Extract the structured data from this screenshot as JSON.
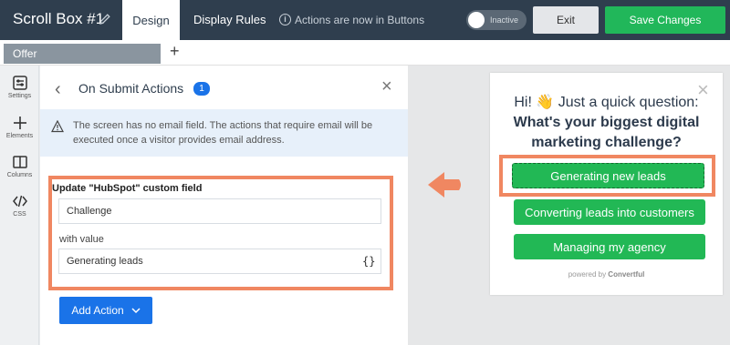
{
  "header": {
    "title": "Scroll Box #1",
    "tabs": [
      "Design",
      "Display Rules"
    ],
    "notice": "Actions are now in Buttons",
    "toggle_label": "Inactive",
    "exit_label": "Exit",
    "save_label": "Save Changes"
  },
  "subtabs": {
    "active": "Offer",
    "add": "+"
  },
  "sidebar": {
    "items": [
      {
        "label": "Settings",
        "icon": "settings-icon"
      },
      {
        "label": "Elements",
        "icon": "plus-icon"
      },
      {
        "label": "Columns",
        "icon": "columns-icon"
      },
      {
        "label": "CSS",
        "icon": "code-icon"
      }
    ]
  },
  "panel": {
    "title": "On Submit Actions",
    "badge": "1",
    "warning": "The screen has no email field. The actions that require email will be executed once a visitor provides email address.",
    "action_title": "Update \"HubSpot\" custom field",
    "field_value": "Challenge",
    "with_value_label": "with value",
    "value": "Generating leads",
    "brace_icon": "{}",
    "add_action_label": "Add Action"
  },
  "popup": {
    "line1": "Hi! 👋 Just a quick question:",
    "line2": "What's your biggest digital marketing challenge?",
    "options": [
      "Generating new leads",
      "Converting leads into customers",
      "Managing my agency"
    ],
    "powered_prefix": "powered by",
    "powered_brand": "Convertful"
  },
  "colors": {
    "accent_green": "#21b75a",
    "accent_blue": "#1a73e8",
    "highlight": "#f08761",
    "topbar": "#2f3e4e"
  }
}
